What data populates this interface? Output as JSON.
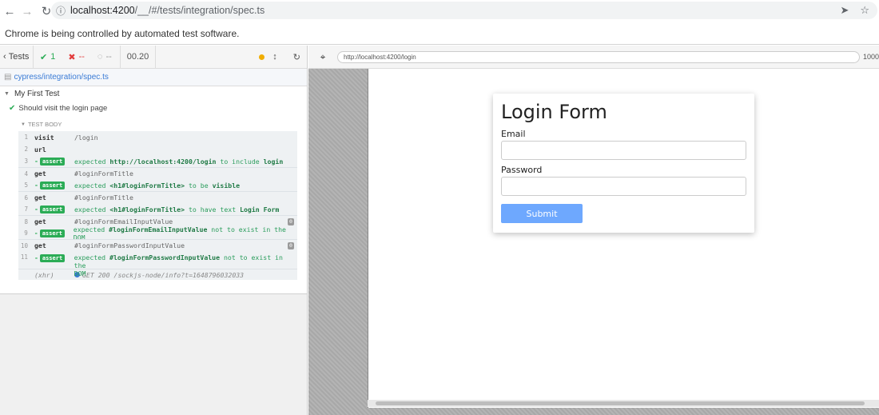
{
  "browser": {
    "url_host": "localhost:4200",
    "url_path": "/__/#/tests/integration/spec.ts",
    "automation_notice": "Chrome is being controlled by automated test software."
  },
  "reporter": {
    "tests_label": "Tests",
    "passed": "1",
    "failed": "--",
    "pending": "--",
    "duration": "00.20",
    "spec_file": "cypress/integration/spec.ts",
    "suite_title": "My First Test",
    "test_title": "Should visit the login page",
    "test_body_label": "TEST BODY",
    "commands": [
      {
        "num": "1",
        "name": "visit",
        "msg": "/login"
      },
      {
        "num": "2",
        "name": "url",
        "msg": ""
      },
      {
        "num": "3",
        "assert": true,
        "pre": "expected ",
        "b1": "http://localhost:4200/login",
        "mid": " to include ",
        "b2": "login"
      },
      {
        "num": "4",
        "name": "get",
        "msg": "#loginFormTitle"
      },
      {
        "num": "5",
        "assert": true,
        "pre": "expected ",
        "b1": "<h1#loginFormTitle>",
        "mid": " to be ",
        "b2": "visible"
      },
      {
        "num": "6",
        "name": "get",
        "msg": "#loginFormTitle"
      },
      {
        "num": "7",
        "assert": true,
        "pre": "expected ",
        "b1": "<h1#loginFormTitle>",
        "mid": " to have text ",
        "b2": "Login Form"
      },
      {
        "num": "8",
        "name": "get",
        "msg": "#loginFormEmailInputValue",
        "badge": "0"
      },
      {
        "num": "9",
        "assert": true,
        "pre": "expected ",
        "b1": "#loginFormEmailInputValue",
        "mid": " not to exist in the DOM",
        "b2": ""
      },
      {
        "num": "10",
        "name": "get",
        "msg": "#loginFormPasswordInputValue",
        "badge": "0"
      },
      {
        "num": "11",
        "assert": true,
        "pre": "expected ",
        "b1": "#loginFormPasswordInputValue",
        "mid": " not to exist in the",
        "b2": "",
        "wrap": "DOM"
      }
    ],
    "assert_label": "assert",
    "xhr_label": "(xhr)",
    "xhr_msg": "GET 200 /sockjs-node/info?t=1648796032033"
  },
  "aut": {
    "url": "http://localhost:4200/login",
    "viewport_size": "1000"
  },
  "login_form": {
    "title": "Login Form",
    "email_label": "Email",
    "password_label": "Password",
    "submit_label": "Submit"
  },
  "colors": {
    "pass_green": "#2bac56",
    "fail_red": "#e23c3c",
    "submit_blue": "#6ea8fe",
    "link_blue": "#3a7bd5"
  }
}
